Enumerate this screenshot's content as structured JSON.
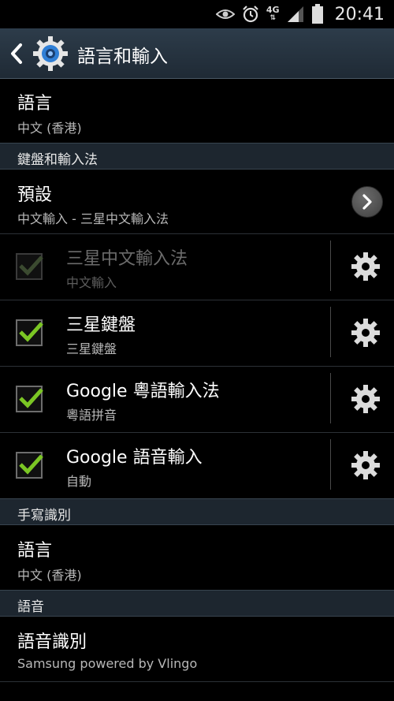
{
  "status_bar": {
    "time": "20:41",
    "network": "4G",
    "icons": [
      "eye-icon",
      "alarm-icon",
      "signal-icon",
      "battery-icon"
    ]
  },
  "action_bar": {
    "title": "語言和輸入",
    "icon": "settings-gear-icon"
  },
  "language_pref": {
    "title": "語言",
    "value": "中文 (香港)"
  },
  "section_keyboard": {
    "label": "鍵盤和輸入法"
  },
  "default_pref": {
    "title": "預設",
    "value": "中文輸入 - 三星中文輸入法"
  },
  "input_methods": [
    {
      "title": "三星中文輸入法",
      "subtitle": "中文輸入",
      "checked": true,
      "enabled": false
    },
    {
      "title": "三星鍵盤",
      "subtitle": "三星鍵盤",
      "checked": true,
      "enabled": true
    },
    {
      "title": "Google 粵語輸入法",
      "subtitle": "粵語拼音",
      "checked": true,
      "enabled": true
    },
    {
      "title": "Google 語音輸入",
      "subtitle": "自動",
      "checked": true,
      "enabled": true
    }
  ],
  "section_handwriting": {
    "label": "手寫識別"
  },
  "handwriting_language": {
    "title": "語言",
    "value": "中文 (香港)"
  },
  "section_speech": {
    "label": "語音"
  },
  "speech_recognition": {
    "title": "語音識別",
    "value": "Samsung powered by Vlingo"
  },
  "colors": {
    "accent_check": "#7bc624",
    "header_bg": "#1d262f",
    "action_bar": "#26333f"
  }
}
